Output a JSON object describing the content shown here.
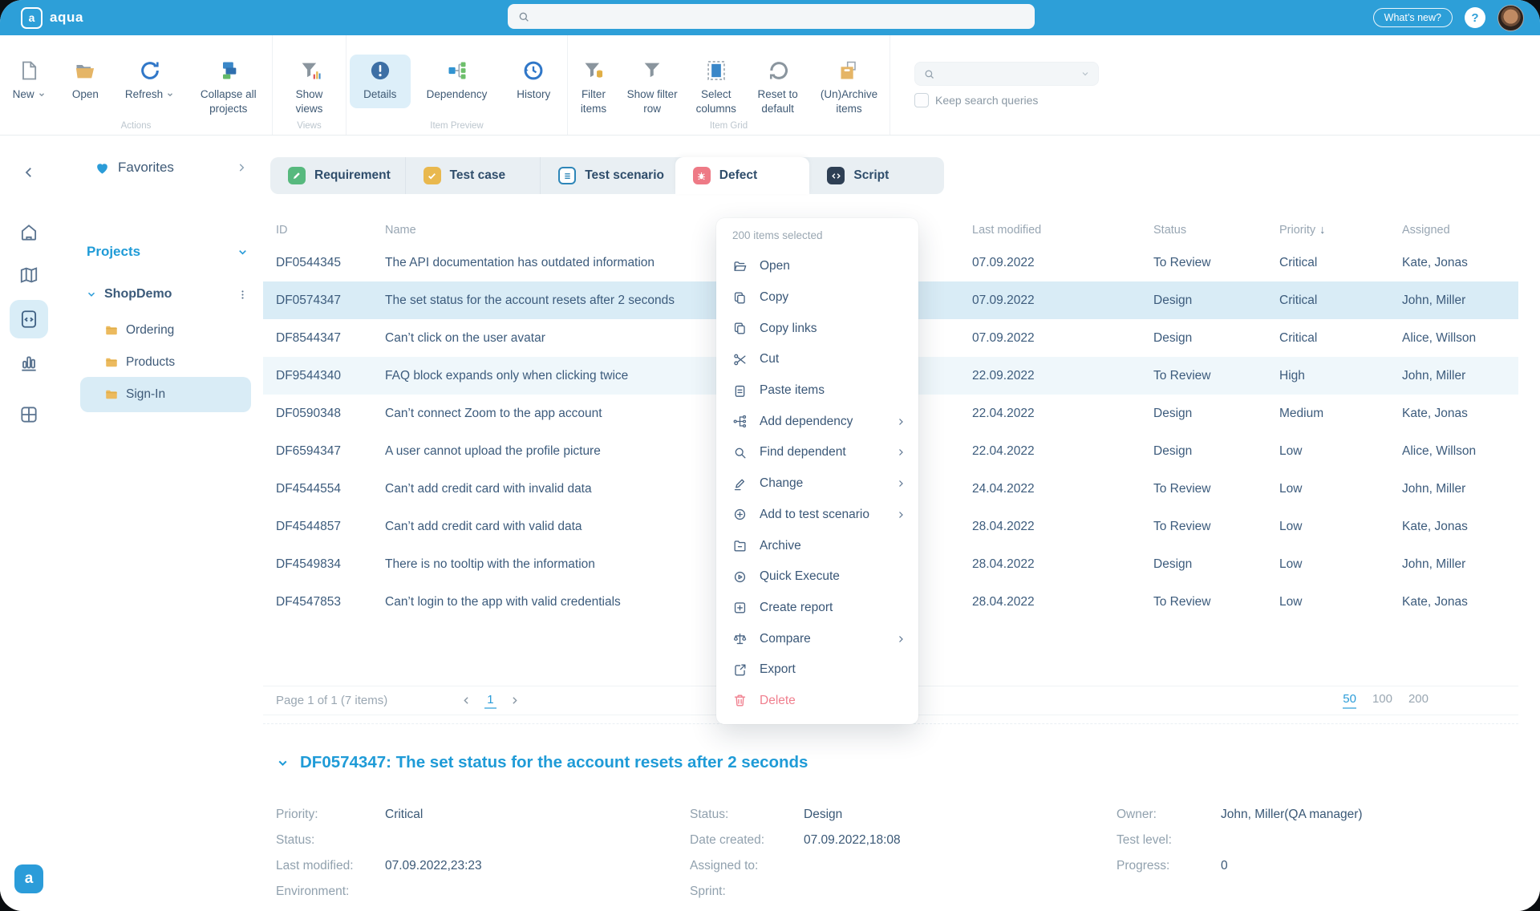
{
  "header": {
    "brand": "aqua",
    "whats_new": "What’s new?",
    "help": "?"
  },
  "ribbon": {
    "actions": {
      "group": "Actions",
      "new": "New",
      "open": "Open",
      "refresh": "Refresh",
      "collapse": "Collapse all projects"
    },
    "views": {
      "group": "Views",
      "show_views": "Show views"
    },
    "item_preview": {
      "group": "Item Preview",
      "details": "Details",
      "dependency": "Dependency",
      "history": "History"
    },
    "item_grid": {
      "group": "Item Grid",
      "filter_items": "Filter items",
      "show_filter_row": "Show filter row",
      "select_columns": "Select columns",
      "reset_default": "Reset to default",
      "unarchive": "(Un)Archive items"
    },
    "search": {
      "keep_label": "Keep search queries"
    }
  },
  "sidebar": {
    "favorites": "Favorites",
    "projects": "Projects",
    "project": "ShopDemo",
    "folders": [
      "Ordering",
      "Products",
      "Sign-In"
    ],
    "selected_folder": "Sign-In"
  },
  "tabs": [
    {
      "label": "Requirement",
      "icon": "requirement-icon",
      "color": "#57b97e"
    },
    {
      "label": "Test case",
      "icon": "test-case-icon",
      "color": "#e9b84e"
    },
    {
      "label": "Test scenario",
      "icon": "test-scenario-icon",
      "color": "#2e86b8"
    },
    {
      "label": "Defect",
      "icon": "defect-icon",
      "color": "#ee7a86",
      "active": true
    },
    {
      "label": "Script",
      "icon": "script-icon",
      "color": "#2e3f54"
    }
  ],
  "grid": {
    "columns": {
      "id": "ID",
      "name": "Name",
      "modified": "Last modified",
      "status": "Status",
      "priority": "Priority",
      "assigned": "Assigned"
    },
    "sort_indicator": "↓",
    "rows": [
      {
        "id": "DF0544345",
        "name": "The API documentation has outdated information",
        "modified": "07.09.2022",
        "status": "To Review",
        "priority": "Critical",
        "assigned": "Kate, Jonas"
      },
      {
        "id": "DF0574347",
        "name": "The set status for the account resets after 2 seconds",
        "modified": "07.09.2022",
        "status": "Design",
        "priority": "Critical",
        "assigned": "John, Miller"
      },
      {
        "id": "DF8544347",
        "name": "Can’t click on the user avatar",
        "modified": "07.09.2022",
        "status": "Design",
        "priority": "Critical",
        "assigned": "Alice, Willson"
      },
      {
        "id": "DF9544340",
        "name": "FAQ block expands only when clicking twice",
        "modified": "22.09.2022",
        "status": "To Review",
        "priority": "High",
        "assigned": "John, Miller"
      },
      {
        "id": "DF0590348",
        "name": "Can’t connect Zoom to the app account",
        "modified": "22.04.2022",
        "status": "Design",
        "priority": "Medium",
        "assigned": "Kate, Jonas"
      },
      {
        "id": "DF6594347",
        "name": "A user cannot upload the profile picture",
        "modified": "22.04.2022",
        "status": "Design",
        "priority": "Low",
        "assigned": "Alice, Willson"
      },
      {
        "id": "DF4544554",
        "name": "Can’t add credit card with invalid data",
        "modified": "24.04.2022",
        "status": "To Review",
        "priority": "Low",
        "assigned": "John, Miller"
      },
      {
        "id": "DF4544857",
        "name": "Can’t add credit card with valid data",
        "modified": "28.04.2022",
        "status": "To Review",
        "priority": "Low",
        "assigned": "Kate, Jonas"
      },
      {
        "id": "DF4549834",
        "name": "There is no tooltip with the information",
        "modified": "28.04.2022",
        "status": "Design",
        "priority": "Low",
        "assigned": "John, Miller"
      },
      {
        "id": "DF4547853",
        "name": "Can’t login to the app with valid credentials",
        "modified": "28.04.2022",
        "status": "To Review",
        "priority": "Low",
        "assigned": "Kate, Jonas"
      }
    ],
    "pager": {
      "summary": "Page 1 of 1 (7 items)",
      "page": "1",
      "sizes": [
        "50",
        "100",
        "200"
      ],
      "active_size": "50"
    }
  },
  "menu": {
    "header": "200 items selected",
    "items": [
      {
        "label": "Open",
        "icon": "open-folder-icon"
      },
      {
        "label": "Copy",
        "icon": "copy-icon"
      },
      {
        "label": "Copy links",
        "icon": "copy-icon"
      },
      {
        "label": "Cut",
        "icon": "scissors-icon"
      },
      {
        "label": "Paste items",
        "icon": "clipboard-icon"
      },
      {
        "label": "Add dependency",
        "icon": "dependency-icon",
        "submenu": true
      },
      {
        "label": "Find dependent",
        "icon": "search-icon",
        "submenu": true
      },
      {
        "label": "Change",
        "icon": "pencil-icon",
        "submenu": true
      },
      {
        "label": "Add to test scenario",
        "icon": "circle-plus-icon",
        "submenu": true
      },
      {
        "label": "Archive",
        "icon": "archive-icon"
      },
      {
        "label": "Quick Execute",
        "icon": "play-circle-icon"
      },
      {
        "label": "Create report",
        "icon": "report-icon"
      },
      {
        "label": "Compare",
        "icon": "scales-icon",
        "submenu": true
      },
      {
        "label": "Export",
        "icon": "export-icon"
      },
      {
        "label": "Delete",
        "icon": "trash-icon",
        "danger": true
      }
    ]
  },
  "detail": {
    "title": "DF0574347: The set status for the account resets after 2 seconds",
    "col1": {
      "l1": "Priority:",
      "v1": "Critical",
      "l2": "Status:",
      "v2": "",
      "l3": "Last modified:",
      "v3": "07.09.2022,23:23",
      "l4": "Environment:",
      "v4": ""
    },
    "col2": {
      "l1": "Status:",
      "v1": "Design",
      "l2": "Date created:",
      "v2": "07.09.2022,18:08",
      "l3": "Assigned to:",
      "v3": "",
      "l4": "Sprint:",
      "v4": ""
    },
    "col3": {
      "l1": "Owner:",
      "v1": "John, Miller(QA manager)",
      "l2": "Test level:",
      "v2": "",
      "l3": "Progress:",
      "v3": "0"
    }
  },
  "colors": {
    "brand_blue": "#2d9fd8",
    "accent": "#1f9bd7",
    "selected_row": "#d9ecf6",
    "danger": "#f07f8e"
  }
}
